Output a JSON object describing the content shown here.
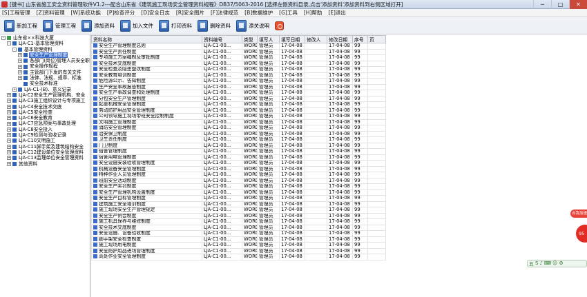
{
  "window": {
    "title": "[键书] 山东省施工安全资料管理软件V1.2---配合山东省《建筑施工现场安全管理资料规程》DB37/5063-2016   [选择左侧资料目录,点击'添加资料'添加资料到右侧区域打开]",
    "minimize": "─",
    "maximize": "□",
    "close": "✕"
  },
  "menu": [
    "[S]工程管理",
    "[Z]资料管理",
    "[W]系统功能",
    "[P]检查评分",
    "[D]安全日志",
    "[R]安全图片",
    "[F]法律规范",
    "[B]数据维护",
    "[G]工具",
    "[H]帮助",
    "[E]退出"
  ],
  "toolbar": [
    {
      "label": "新加工程",
      "icon": "new-project-icon"
    },
    {
      "label": "管理工程",
      "icon": "manage-project-icon"
    },
    {
      "label": "添加资料",
      "icon": "add-document-icon"
    },
    {
      "label": "加入文件",
      "icon": "import-file-icon"
    },
    {
      "label": "打印资料",
      "icon": "print-icon"
    },
    {
      "label": "删除资料",
      "icon": "delete-document-icon"
    },
    {
      "label": "添关说明",
      "icon": "help-icon"
    },
    {
      "label": "",
      "icon": "exit-icon"
    }
  ],
  "tree": [
    {
      "level": 0,
      "label": "山东省××科技大厦",
      "expander": "-",
      "root": true
    },
    {
      "level": 1,
      "label": "LJA-C1-基本管理资料",
      "expander": "-"
    },
    {
      "level": 2,
      "label": "基本管理资料",
      "expander": "-"
    },
    {
      "level": 3,
      "label": "安全生产管理制度",
      "expander": "+",
      "selected": true
    },
    {
      "level": 3,
      "label": "各部门(岗位)管理人员安全职责",
      "expander": "+"
    },
    {
      "level": 3,
      "label": "安全操作规程",
      "expander": "+"
    },
    {
      "level": 3,
      "label": "主管部门下发的有关文件",
      "expander": "+"
    },
    {
      "level": 3,
      "label": "法律、法规、规章、标准",
      "expander": "+"
    },
    {
      "level": 3,
      "label": "安全技术标准",
      "expander": ""
    },
    {
      "level": 2,
      "label": "LJA-C1-(B)、意义记录",
      "expander": "+"
    },
    {
      "level": 1,
      "label": "LJA-C2安全生产管理机构、安全",
      "expander": "+"
    },
    {
      "level": 1,
      "label": "LJA-C3施工组织设计与专项施工",
      "expander": "+"
    },
    {
      "level": 1,
      "label": "LJA-C4安全技术交底",
      "expander": "+"
    },
    {
      "level": 1,
      "label": "LJA-C5安全检查",
      "expander": "+"
    },
    {
      "level": 1,
      "label": "LJA-C6安全教育",
      "expander": "+"
    },
    {
      "level": 1,
      "label": "LJA-C7应急预案与事故处理",
      "expander": "+"
    },
    {
      "level": 1,
      "label": "LJA-C8安全投入",
      "expander": "+"
    },
    {
      "level": 1,
      "label": "LJA-C9检测与验收记录",
      "expander": "+"
    },
    {
      "level": 1,
      "label": "LJA-C10文明施工",
      "expander": "+"
    },
    {
      "level": 1,
      "label": "LJA-C11脚手架及建筑结构安全",
      "expander": "+"
    },
    {
      "level": 1,
      "label": "LJA-C12建设单位安全管理资料",
      "expander": "+"
    },
    {
      "level": 1,
      "label": "LJA-C13监理单位安全管理资料",
      "expander": "+"
    },
    {
      "level": 1,
      "label": "其他资料",
      "expander": "+"
    }
  ],
  "grid": {
    "columns": [
      "资料名称",
      "资料编号",
      "类型",
      "填写人",
      "填写日期",
      "修改人",
      "修改日期",
      "序号",
      "页"
    ],
    "rows": [
      [
        "安全生产管理制度总则",
        "LJA-C1-00...",
        "WORD",
        "管理员",
        "17-04-08",
        "",
        "17-04-08",
        "99",
        ""
      ],
      [
        "安全生产责任制度",
        "LJA-C1-00...",
        "WORD",
        "管理员",
        "17-04-08",
        "",
        "17-04-08",
        "99",
        ""
      ],
      [
        "专项施工方案编制及审批制度",
        "LJA-C1-00...",
        "WORD",
        "管理员",
        "17-04-08",
        "",
        "17-04-08",
        "99",
        ""
      ],
      [
        "安全技术交底制度",
        "LJA-C1-00...",
        "WORD",
        "管理员",
        "17-04-08",
        "",
        "17-04-08",
        "99",
        ""
      ],
      [
        "安全检查及隐患整改制度",
        "LJA-C1-00...",
        "WORD",
        "管理员",
        "17-04-08",
        "",
        "17-04-08",
        "99",
        ""
      ],
      [
        "安全教育培训制度",
        "LJA-C1-00...",
        "WORD",
        "管理员",
        "17-04-08",
        "",
        "17-04-08",
        "99",
        ""
      ],
      [
        "危险源公示、告知制度",
        "LJA-C1-00...",
        "WORD",
        "管理员",
        "17-04-08",
        "",
        "17-04-08",
        "99",
        ""
      ],
      [
        "生产安全事故报告制度",
        "LJA-C1-00...",
        "WORD",
        "管理员",
        "17-04-08",
        "",
        "17-04-08",
        "99",
        ""
      ],
      [
        "安全生产事故调查和处理制度",
        "LJA-C1-00...",
        "WORD",
        "管理员",
        "17-04-08",
        "",
        "17-04-08",
        "99",
        ""
      ],
      [
        "分包安全生产管理制度",
        "LJA-C1-00...",
        "WORD",
        "管理员",
        "17-04-08",
        "",
        "17-04-08",
        "99",
        ""
      ],
      [
        "起重机械安全管理制度",
        "LJA-C1-00...",
        "WORD",
        "管理员",
        "17-04-08",
        "",
        "17-04-08",
        "99",
        ""
      ],
      [
        "劳动防护用品安全管理制度",
        "LJA-C1-00...",
        "WORD",
        "管理员",
        "17-04-08",
        "",
        "17-04-08",
        "99",
        ""
      ],
      [
        "公司领导施工现场带班安全控制制度",
        "LJA-C1-00...",
        "WORD",
        "管理员",
        "17-04-08",
        "",
        "17-04-08",
        "99",
        ""
      ],
      [
        "文明施工管理制度",
        "LJA-C1-00...",
        "WORD",
        "管理员",
        "17-04-08",
        "",
        "17-04-08",
        "99",
        ""
      ],
      [
        "消防安全管理制度",
        "LJA-C1-00...",
        "WORD",
        "管理员",
        "17-04-08",
        "",
        "17-04-08",
        "99",
        ""
      ],
      [
        "治安保卫制度",
        "LJA-C1-00...",
        "WORD",
        "管理员",
        "17-04-08",
        "",
        "17-04-08",
        "99",
        ""
      ],
      [
        "卫生责任制度",
        "LJA-C1-00...",
        "WORD",
        "管理员",
        "17-04-08",
        "",
        "17-04-08",
        "99",
        ""
      ],
      [
        "门卫制度",
        "LJA-C1-00...",
        "WORD",
        "管理员",
        "17-04-08",
        "",
        "17-04-08",
        "99",
        ""
      ],
      [
        "宿舍管理制度",
        "LJA-C1-00...",
        "WORD",
        "管理员",
        "17-04-08",
        "",
        "17-04-08",
        "99",
        ""
      ],
      [
        "宿舍用电管理制度",
        "LJA-C1-00...",
        "WORD",
        "管理员",
        "17-04-08",
        "",
        "17-04-08",
        "99",
        ""
      ],
      [
        "安全设施安装验收管理制度",
        "LJA-C1-00...",
        "WORD",
        "管理员",
        "17-04-08",
        "",
        "17-04-08",
        "99",
        ""
      ],
      [
        "机械设备安全管理制度",
        "LJA-C1-00...",
        "WORD",
        "管理员",
        "17-04-08",
        "",
        "17-04-08",
        "99",
        ""
      ],
      [
        "特种作业人员管理制度",
        "LJA-C1-00...",
        "WORD",
        "管理员",
        "17-04-08",
        "",
        "17-04-08",
        "99",
        ""
      ],
      [
        "班前安全活动制度",
        "LJA-C1-00...",
        "WORD",
        "管理员",
        "17-04-08",
        "",
        "17-04-08",
        "99",
        ""
      ],
      [
        "安全生产奖罚制度",
        "LJA-C1-00...",
        "WORD",
        "管理员",
        "17-04-08",
        "",
        "17-04-08",
        "99",
        ""
      ],
      [
        "安全生产管理机构设置制度",
        "LJA-C1-00...",
        "WORD",
        "管理员",
        "17-04-08",
        "",
        "17-04-08",
        "99",
        ""
      ],
      [
        "安全生产目标管理制度",
        "LJA-C1-00...",
        "WORD",
        "管理员",
        "17-04-08",
        "",
        "17-04-08",
        "99",
        ""
      ],
      [
        "建筑施工安全培训制度",
        "LJA-C1-00...",
        "WORD",
        "管理员",
        "17-04-08",
        "",
        "17-04-08",
        "99",
        ""
      ],
      [
        "施工现场安全生产管理规定",
        "LJA-C1-00...",
        "WORD",
        "管理员",
        "17-04-08",
        "",
        "17-04-08",
        "99",
        ""
      ],
      [
        "安全生产例会制度",
        "LJA-C1-00...",
        "WORD",
        "管理员",
        "17-04-08",
        "",
        "17-04-08",
        "99",
        ""
      ],
      [
        "施工机具保养与维修制度",
        "LJA-C1-00...",
        "WORD",
        "管理员",
        "17-04-08",
        "",
        "17-04-08",
        "99",
        ""
      ],
      [
        "安全技术交底制度",
        "LJA-C1-00...",
        "WORD",
        "管理员",
        "17-04-08",
        "",
        "17-04-08",
        "99",
        ""
      ],
      [
        "安全设施、设备验收制度",
        "LJA-C1-00...",
        "WORD",
        "管理员",
        "17-04-08",
        "",
        "17-04-08",
        "99",
        ""
      ],
      [
        "脚手架安全检查制度",
        "LJA-C1-00...",
        "WORD",
        "管理员",
        "17-04-08",
        "",
        "17-04-08",
        "99",
        ""
      ],
      [
        "施工现场用电制度",
        "LJA-C1-00...",
        "WORD",
        "管理员",
        "17-04-08",
        "",
        "17-04-08",
        "99",
        ""
      ],
      [
        "安全防护用品进场管理制度",
        "LJA-C1-00...",
        "WORD",
        "管理员",
        "17-04-08",
        "",
        "17-04-08",
        "99",
        ""
      ],
      [
        "高处作业安全管理制度",
        "LJA-C1-00...",
        "WORD",
        "管理员",
        "17-04-08",
        "",
        "17-04-08",
        "99",
        ""
      ]
    ]
  },
  "float_badge": {
    "pill": "点我加速",
    "circle": "95"
  },
  "ime": {
    "label": "五",
    "icons": [
      "S",
      "♪",
      "⌨",
      "☺",
      "⚙"
    ]
  }
}
